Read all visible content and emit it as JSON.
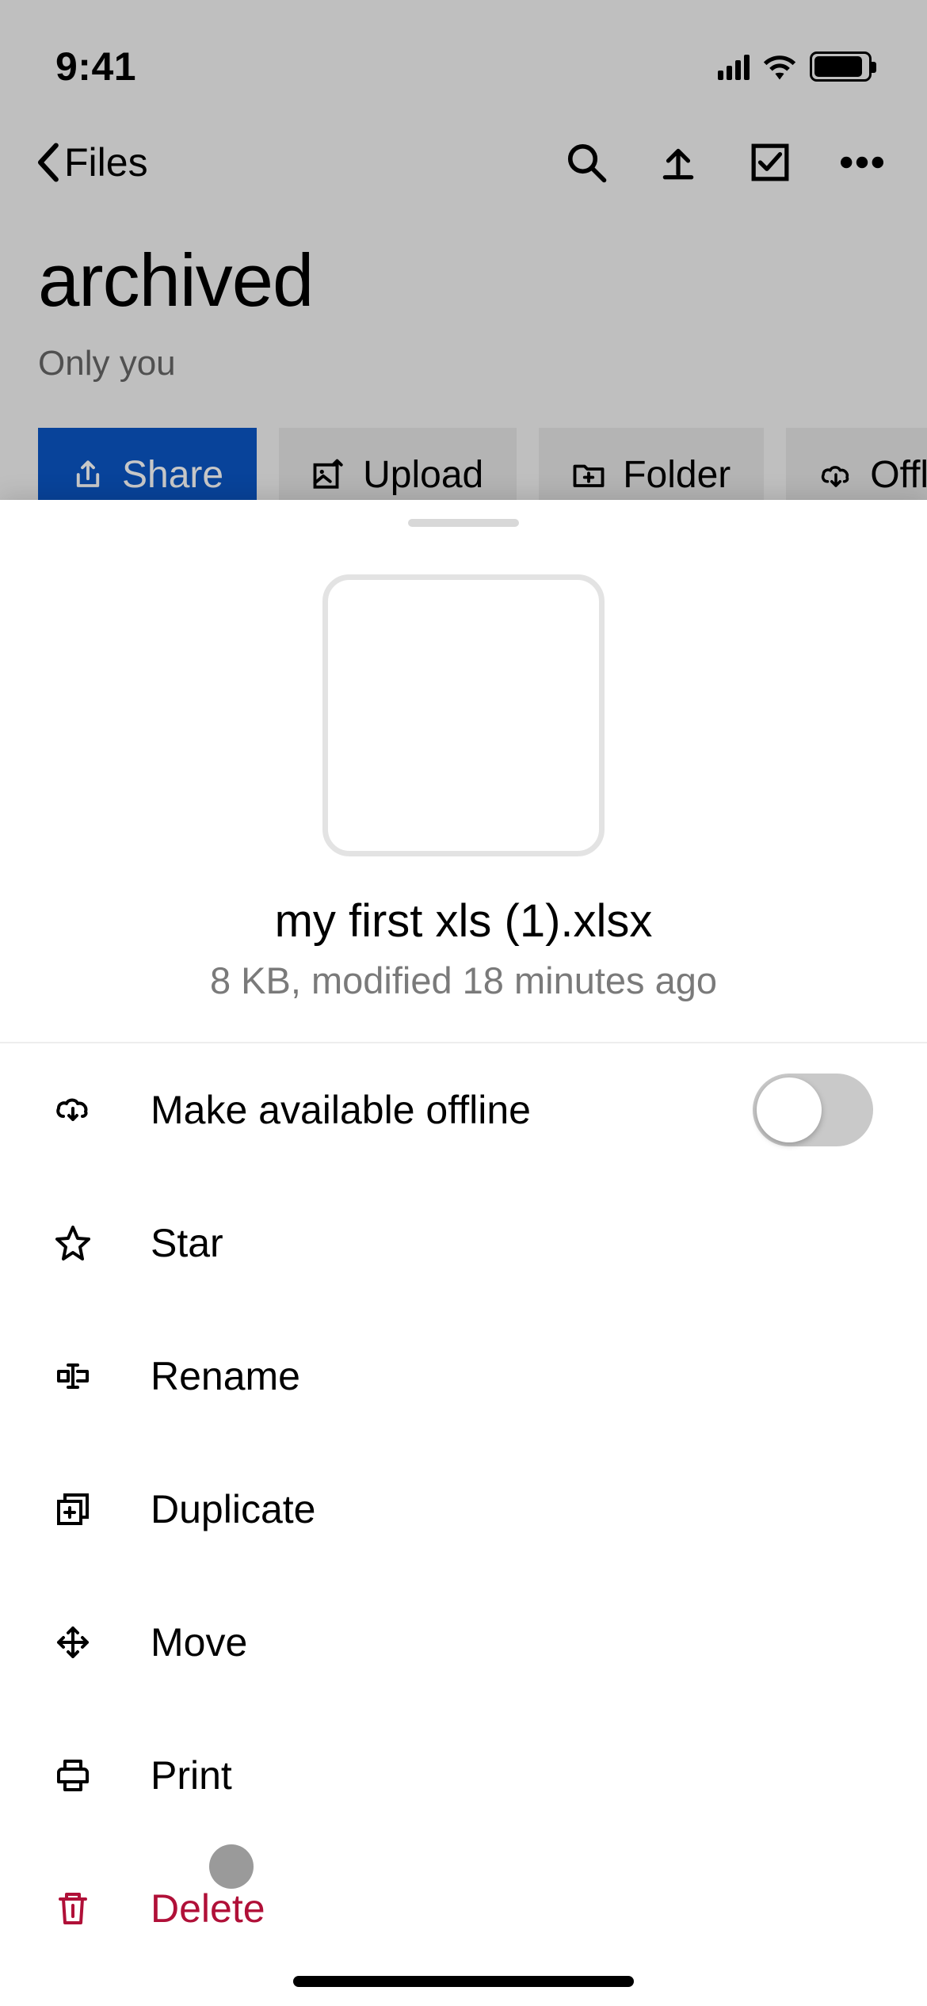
{
  "status": {
    "time": "9:41"
  },
  "nav": {
    "back_label": "Files"
  },
  "folder": {
    "title": "archived",
    "access": "Only you"
  },
  "chips": {
    "share": "Share",
    "upload": "Upload",
    "folder": "Folder",
    "offline": "Offline"
  },
  "sheet": {
    "file_name": "my first xls (1).xlsx",
    "file_meta": "8 KB, modified 18 minutes ago",
    "actions": {
      "offline": "Make available offline",
      "star": "Star",
      "rename": "Rename",
      "duplicate": "Duplicate",
      "move": "Move",
      "print": "Print",
      "delete": "Delete"
    },
    "offline_toggle": false
  }
}
